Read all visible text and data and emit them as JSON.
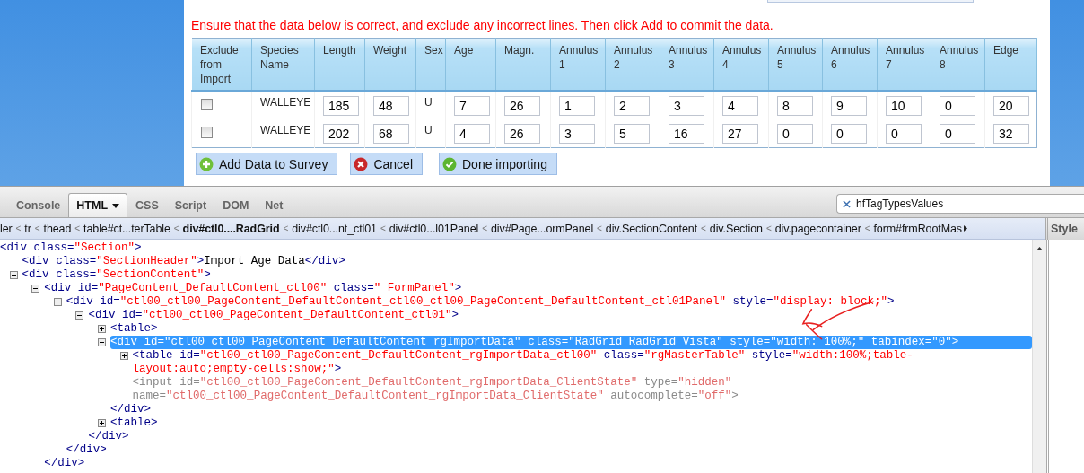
{
  "page": {
    "instruction": "Ensure that the data below is correct, and exclude any incorrect lines. Then click Add to commit the data.",
    "table": {
      "columns": [
        "Exclude\nfrom\nImport",
        "Species\nName",
        "Length",
        "Weight",
        "Sex",
        "Age",
        "Magn.",
        "Annulus\n1",
        "Annulus\n2",
        "Annulus\n3",
        "Annulus\n4",
        "Annulus\n5",
        "Annulus\n6",
        "Annulus\n7",
        "Annulus\n8",
        "Edge"
      ],
      "rows": [
        {
          "cells": [
            {
              "kind": "checkbox",
              "checked": false
            },
            {
              "kind": "text",
              "text": "WALLEYE"
            },
            {
              "kind": "input",
              "value": "185"
            },
            {
              "kind": "input",
              "value": "48"
            },
            {
              "kind": "text",
              "text": "U"
            },
            {
              "kind": "input",
              "value": "7"
            },
            {
              "kind": "input",
              "value": "26"
            },
            {
              "kind": "input",
              "value": "1"
            },
            {
              "kind": "input",
              "value": "2"
            },
            {
              "kind": "input",
              "value": "3"
            },
            {
              "kind": "input",
              "value": "4"
            },
            {
              "kind": "input",
              "value": "8"
            },
            {
              "kind": "input",
              "value": "9"
            },
            {
              "kind": "input",
              "value": "10"
            },
            {
              "kind": "input",
              "value": "0"
            },
            {
              "kind": "input",
              "value": "20"
            }
          ]
        },
        {
          "cells": [
            {
              "kind": "checkbox",
              "checked": false
            },
            {
              "kind": "text",
              "text": "WALLEYE"
            },
            {
              "kind": "input",
              "value": "202"
            },
            {
              "kind": "input",
              "value": "68"
            },
            {
              "kind": "text",
              "text": "U"
            },
            {
              "kind": "input",
              "value": "4"
            },
            {
              "kind": "input",
              "value": "26"
            },
            {
              "kind": "input",
              "value": "3"
            },
            {
              "kind": "input",
              "value": "5"
            },
            {
              "kind": "input",
              "value": "16"
            },
            {
              "kind": "input",
              "value": "27"
            },
            {
              "kind": "input",
              "value": "0"
            },
            {
              "kind": "input",
              "value": "0"
            },
            {
              "kind": "input",
              "value": "0"
            },
            {
              "kind": "input",
              "value": "0"
            },
            {
              "kind": "input",
              "value": "32"
            }
          ]
        }
      ]
    },
    "buttons": [
      {
        "label": "Add Data to Survey",
        "kind": "add"
      },
      {
        "label": "Cancel",
        "kind": "cancel"
      },
      {
        "label": "Done importing",
        "kind": "done"
      }
    ]
  },
  "devtools": {
    "tabs": [
      {
        "label": "Console",
        "selected": false,
        "menu": false
      },
      {
        "label": "HTML",
        "selected": true,
        "menu": true
      },
      {
        "label": "CSS",
        "selected": false,
        "menu": false
      },
      {
        "label": "Script",
        "selected": false,
        "menu": false
      },
      {
        "label": "DOM",
        "selected": false,
        "menu": false
      },
      {
        "label": "Net",
        "selected": false,
        "menu": false
      }
    ],
    "search": {
      "value": "hfTagTypesValues"
    },
    "breadcrumb": {
      "separator": "<",
      "items": [
        {
          "label": "ler",
          "selected": false
        },
        {
          "label": "tr",
          "selected": false
        },
        {
          "label": "thead",
          "selected": false
        },
        {
          "label": "table#ct...terTable",
          "selected": false
        },
        {
          "label": "div#ctl0....RadGrid",
          "selected": true
        },
        {
          "label": "div#ctl0...nt_ctl01",
          "selected": false
        },
        {
          "label": "div#ctl0...l01Panel",
          "selected": false
        },
        {
          "label": "div#Page...ormPanel",
          "selected": false
        },
        {
          "label": "div.SectionContent",
          "selected": false
        },
        {
          "label": "div.Section",
          "selected": false
        },
        {
          "label": "div.pagecontainer",
          "selected": false
        },
        {
          "label": "form#frmRootMas",
          "selected": false
        }
      ]
    },
    "side_panel": {
      "title": "Style"
    },
    "tree": [
      {
        "text": "<div class=\"Section\">",
        "selected": false,
        "greyed": false,
        "children": [
          {
            "text": "<div class=\"SectionHeader\">Import Age Data</div>",
            "selected": false,
            "greyed": false
          },
          {
            "text": "<div class=\"SectionContent\">",
            "expanded": true,
            "selected": false,
            "greyed": false,
            "children": [
              {
                "text": "<div id=\"PageContent_DefaultContent_ctl00\" class=\" FormPanel\">",
                "expanded": true,
                "selected": false,
                "greyed": false,
                "close": "</div>",
                "children": [
                  {
                    "text": "<div id=\"ctl00_ctl00_PageContent_DefaultContent_ctl00_ctl00_PageContent_DefaultContent_ctl01Panel\" style=\"display: block;\">",
                    "expanded": true,
                    "selected": false,
                    "greyed": false,
                    "close": "</div>",
                    "children": [
                      {
                        "text": "<div id=\"ctl00_ctl00_PageContent_DefaultContent_ctl01\">",
                        "expanded": true,
                        "selected": false,
                        "greyed": false,
                        "close": "</div>",
                        "children": [
                          {
                            "text": "<table>",
                            "expanded": false,
                            "selected": false,
                            "greyed": false
                          },
                          {
                            "text": "<div id=\"ctl00_ctl00_PageContent_DefaultContent_rgImportData\" class=\"RadGrid RadGrid_Vista\" style=\"width: 100%;\" tabindex=\"0\">",
                            "expanded": true,
                            "selected": true,
                            "greyed": false,
                            "close": "</div>",
                            "children": [
                              {
                                "text": "<table id=\"ctl00_ctl00_PageContent_DefaultContent_rgImportData_ctl00\" class=\"rgMasterTable\" style=\"width:100%;table-layout:auto;empty-cells:show;\">",
                                "expanded": false,
                                "selected": false,
                                "greyed": false
                              },
                              {
                                "text": "<input id=\"ctl00_ctl00_PageContent_DefaultContent_rgImportData_ClientState\" type=\"hidden\" name=\"ctl00_ctl00_PageContent_DefaultContent_rgImportData_ClientState\" autocomplete=\"off\">",
                                "selected": false,
                                "greyed": true
                              }
                            ]
                          },
                          {
                            "text": "<table>",
                            "expanded": false,
                            "selected": false,
                            "greyed": false
                          }
                        ]
                      }
                    ]
                  }
                ]
              }
            ]
          }
        ]
      }
    ]
  }
}
